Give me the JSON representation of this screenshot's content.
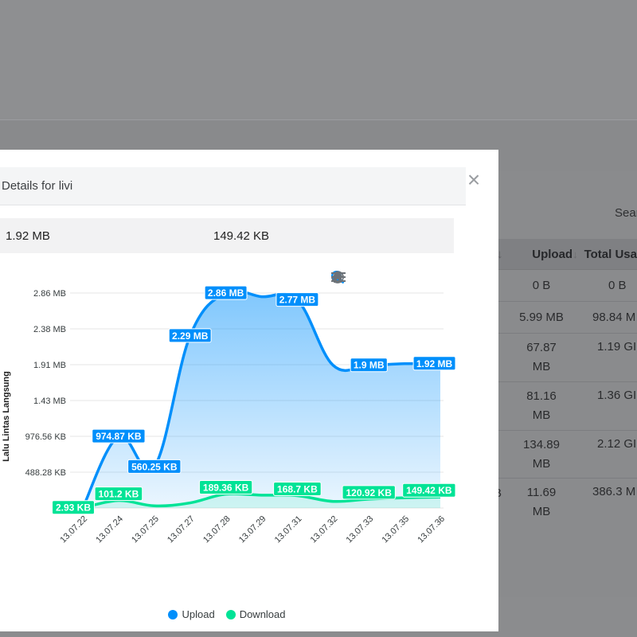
{
  "background": {
    "search_label": "Sear",
    "table": {
      "headers": [
        "Upload",
        "Total Usa"
      ],
      "rows": [
        {
          "stub": "",
          "upload": "0 B",
          "total": "0 B"
        },
        {
          "stub": "",
          "upload": "5.99 MB",
          "total": "98.84 M"
        },
        {
          "stub": "",
          "upload": "67.87 MB",
          "total": "1.19 GI"
        },
        {
          "stub": "",
          "upload": "81.16 MB",
          "total": "1.36 GI"
        },
        {
          "stub": "",
          "upload": "134.89 MB",
          "total": "2.12 GI"
        },
        {
          "stub": "B",
          "upload": "11.69 MB",
          "total": "386.3 M"
        }
      ]
    }
  },
  "modal": {
    "title": "Details for livi",
    "close_glyph": "×",
    "stats": [
      "1.92 MB",
      "149.42 KB"
    ]
  },
  "toolbar": {
    "icons": [
      "zoom-in-icon",
      "zoom-out-icon",
      "zoom-select-icon",
      "pan-hand-icon",
      "home-reset-icon",
      "menu-icon"
    ]
  },
  "colors": {
    "upload": "#008ffb",
    "download": "#00e396",
    "grid": "#e6e6e6",
    "axis_text": "#373d3f"
  },
  "chart_data": {
    "type": "area",
    "ylabel": "Lalu Lintas Langsung",
    "x": [
      "13.07.22",
      "13.07.24",
      "13.07.25",
      "13.07.27",
      "13.07.28",
      "13.07.29",
      "13.07.31",
      "13.07.32",
      "13.07.33",
      "13.07.35",
      "13.07.36"
    ],
    "yticks": [
      "488.28 KB",
      "976.56 KB",
      "1.43 MB",
      "1.91 MB",
      "2.38 MB",
      "2.86 MB"
    ],
    "ylim_kb": [
      0,
      2929.7
    ],
    "grid": true,
    "legend": "bottom-center",
    "series": [
      {
        "name": "Upload",
        "values_kb": [
          2.93,
          974.87,
          560.25,
          2345,
          2928.6,
          2880,
          2836.5,
          1945.6,
          1945.6,
          1966.1,
          1966.1
        ],
        "labels": [
          null,
          "974.87 KB",
          "560.25 KB",
          "2.29 MB",
          "2.86 MB",
          null,
          "2.77 MB",
          null,
          "1.9 MB",
          null,
          "1.92 MB"
        ]
      },
      {
        "name": "Download",
        "values_kb": [
          2.93,
          101.2,
          30,
          70,
          189.36,
          175,
          168.7,
          90,
          120.92,
          140,
          149.42
        ],
        "labels": [
          "2.93 KB",
          "101.2 KB",
          null,
          null,
          "189.36 KB",
          null,
          "168.7 KB",
          null,
          "120.92 KB",
          null,
          "149.42 KB"
        ]
      }
    ]
  }
}
